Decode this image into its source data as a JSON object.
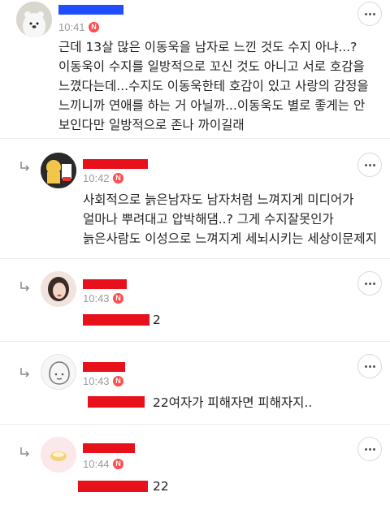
{
  "comments": [
    {
      "time": "10:41",
      "badge": "N",
      "text": "근데 13살 많은 이동욱을 남자로 느낀 것도 수지 아냐...?\n이동욱이 수지를 일방적으로 꼬신 것도 아니고 서로 호감을\n느꼈다는데...수지도 이동욱한테 호감이 있고 사랑의 감정을\n느끼니까 연애를 하는 거 아닐까...이동욱도 별로 좋게는 안\n보인다만 일방적으로 존나 까이길래"
    },
    {
      "time": "10:42",
      "badge": "N",
      "text": "사회적으로 늙은남자도 남자처럼 느껴지게 미디어가\n얼마나 뿌려대고 압박해댐..? 그게 수지잘못인가\n늙은사람도 이성으로 느껴지게 세뇌시키는 세상이문제지"
    },
    {
      "time": "10:43",
      "badge": "N",
      "text": "2"
    },
    {
      "time": "10:43",
      "badge": "N",
      "text": "22여자가 피해자면 피해자지.."
    },
    {
      "time": "10:44",
      "badge": "N",
      "text": "22"
    }
  ],
  "colors": {
    "badge": "#ff4d4d",
    "redaction_red": "#e8101a",
    "redaction_blue": "#1f4dff",
    "time": "#9a9a9a"
  },
  "icons": {
    "reply": "reply-arrow-icon",
    "more": "more-options-icon",
    "new": "new-badge-icon"
  }
}
